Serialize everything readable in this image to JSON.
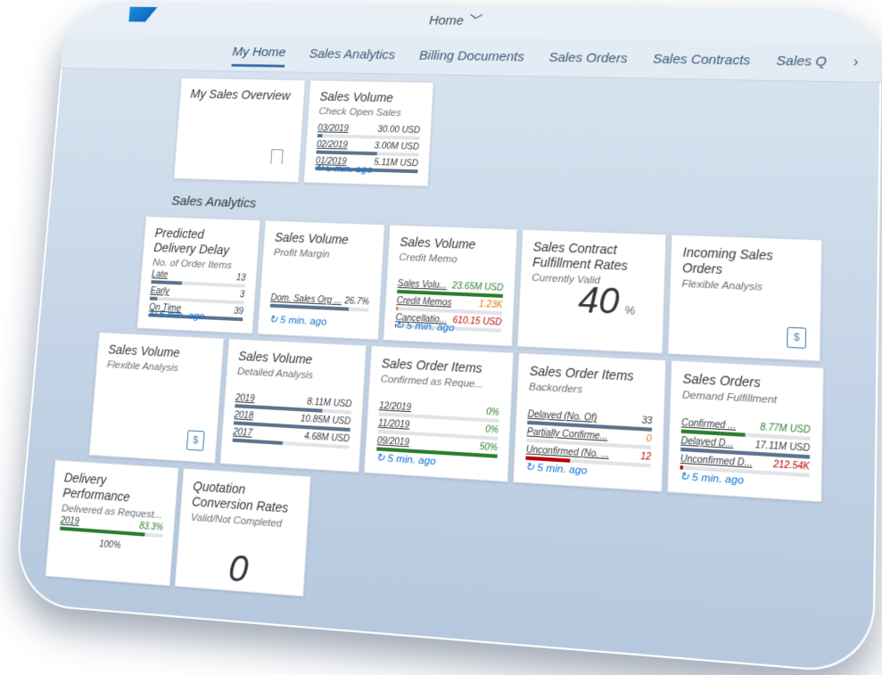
{
  "shell": {
    "title": "Home",
    "title_icon": "chevron-down-icon"
  },
  "tabs": {
    "items": [
      "My Home",
      "Sales Analytics",
      "Billing Documents",
      "Sales Orders",
      "Sales Contracts",
      "Sales Q"
    ],
    "more": "›"
  },
  "tiles": {
    "my_sales_overview": {
      "title": "My Sales Overview",
      "icon": "bookmark-icon"
    },
    "sales_volume_open": {
      "title": "Sales Volume",
      "subtitle": "Check Open Sales",
      "rows": [
        {
          "label": "03/2019",
          "value": "30.00 USD",
          "fill": 0.05
        },
        {
          "label": "02/2019",
          "value": "3.00M USD",
          "fill": 0.6
        },
        {
          "label": "01/2019",
          "value": "5.11M USD",
          "fill": 1.0
        }
      ],
      "footer": "5 min. ago"
    },
    "sales_analytics_group": "Sales Analytics",
    "predicted_delay": {
      "title": "Predicted Delivery Delay",
      "subtitle": "No. of Order Items",
      "rows": [
        {
          "label": "Late",
          "value": "13",
          "fill": 0.33
        },
        {
          "label": "Early",
          "value": "3",
          "fill": 0.08
        },
        {
          "label": "On Time",
          "value": "39",
          "fill": 1.0
        }
      ],
      "footer": "5 min. ago"
    },
    "sales_volume_profit": {
      "title": "Sales Volume",
      "subtitle": "Profit Margin",
      "rows": [
        {
          "label": "Dom. Sales Org ...",
          "value": "26.7%",
          "fill": 0.8
        }
      ],
      "footer": "5 min. ago"
    },
    "sales_volume_credit": {
      "title": "Sales Volume",
      "subtitle": "Credit Memo",
      "rows": [
        {
          "label": "Sales Volu...",
          "value": "23.65M USD",
          "fill": 1.0,
          "color": "#2b7d2b"
        },
        {
          "label": "Credit Memos",
          "value": "1.23K",
          "fill": 0.02,
          "color": "#e9730c"
        },
        {
          "label": "Cancellatio...",
          "value": "610.15 USD",
          "fill": 0.01,
          "color": "#bb0000"
        }
      ],
      "footer": "5 min. ago"
    },
    "contract_fulfillment": {
      "title": "Sales Contract Fulfillment Rates",
      "subtitle": "Currently Valid",
      "value": "40",
      "unit": "%"
    },
    "incoming_orders": {
      "title": "Incoming Sales Orders",
      "subtitle": "Flexible Analysis",
      "icon": "document-dollar-icon"
    },
    "sales_volume_flex": {
      "title": "Sales Volume",
      "subtitle": "Flexible Analysis",
      "icon": "document-dollar-icon"
    },
    "sales_volume_detail": {
      "title": "Sales Volume",
      "subtitle": "Detailed Analysis",
      "rows": [
        {
          "label": "2019",
          "value": "8.11M USD",
          "fill": 0.75
        },
        {
          "label": "2018",
          "value": "10.85M USD",
          "fill": 1.0
        },
        {
          "label": "2017",
          "value": "4.68M USD",
          "fill": 0.43
        }
      ]
    },
    "order_items_confirmed": {
      "title": "Sales Order Items",
      "subtitle": "Confirmed as Reque...",
      "rows": [
        {
          "label": "12/2019",
          "value": "0%",
          "fill": 0.0,
          "color": "#2b7d2b"
        },
        {
          "label": "11/2019",
          "value": "0%",
          "fill": 0.0,
          "color": "#2b7d2b"
        },
        {
          "label": "09/2019",
          "value": "50%",
          "fill": 1.0,
          "color": "#2b7d2b"
        }
      ],
      "footer": "5 min. ago"
    },
    "order_items_backorders": {
      "title": "Sales Order Items",
      "subtitle": "Backorders",
      "rows": [
        {
          "label": "Delayed (No. Of)",
          "value": "33",
          "fill": 1.0
        },
        {
          "label": "Partially Confirme...",
          "value": "0",
          "fill": 0.0,
          "color": "#e9730c"
        },
        {
          "label": "Unconfirmed (No. ...",
          "value": "12",
          "fill": 0.36,
          "color": "#bb0000"
        }
      ],
      "footer": "5 min. ago"
    },
    "sales_orders_demand": {
      "title": "Sales Orders",
      "subtitle": "Demand Fulfillment",
      "rows": [
        {
          "label": "Confirmed ...",
          "value": "8.77M USD",
          "fill": 0.5,
          "color": "#2b7d2b"
        },
        {
          "label": "Delayed D...",
          "value": "17.11M USD",
          "fill": 1.0
        },
        {
          "label": "Unconfirmed D...",
          "value": "212.54K",
          "fill": 0.02,
          "color": "#bb0000"
        }
      ],
      "footer": "5 min. ago"
    },
    "delivery_performance": {
      "title": "Delivery Performance",
      "subtitle": "Delivered as Request...",
      "rows": [
        {
          "label": "2019",
          "value": "83.3%",
          "fill": 0.83,
          "color": "#2b7d2b"
        }
      ],
      "extra": "100%"
    },
    "quotation_conversion": {
      "title": "Quotation Conversion Rates",
      "subtitle": "Valid/Not Completed",
      "value": "0"
    }
  }
}
